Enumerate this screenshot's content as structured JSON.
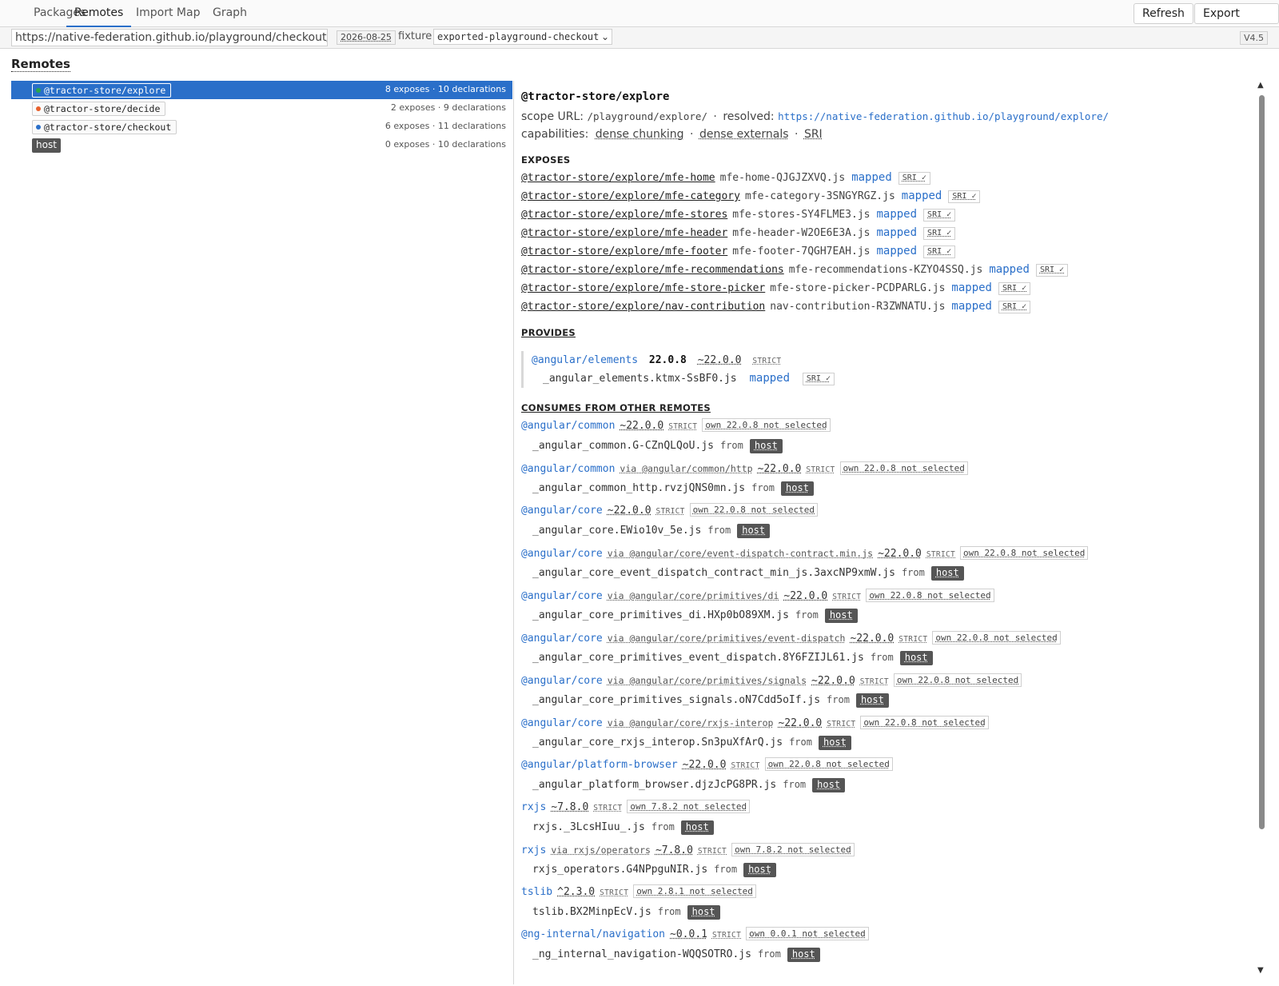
{
  "tabs": [
    "Packages",
    "Remotes",
    "Import Map",
    "Graph"
  ],
  "actions": {
    "refresh": "Refresh",
    "export": "Export JSON"
  },
  "urlbar": {
    "url": "https://native-federation.github.io/playground/checkout/cart",
    "date": "2026-08-25",
    "fixture_label": "fixture",
    "fixture_value": "exported-playground-checkout",
    "version": "V4.5"
  },
  "section_title": "Remotes",
  "remotes": [
    {
      "name": "@tractor-store/explore",
      "counts": "8 exposes · 10 declarations",
      "dot": "#2aa84a"
    },
    {
      "name": "@tractor-store/decide",
      "counts": "2 exposes · 9 declarations",
      "dot": "#e8602c"
    },
    {
      "name": "@tractor-store/checkout",
      "counts": "6 exposes · 11 declarations",
      "dot": "#2a6fc9"
    },
    {
      "name": "host",
      "counts": "0 exposes · 10 declarations"
    }
  ],
  "detail": {
    "title": "@tractor-store/explore",
    "scope_label": "scope URL:",
    "scope": "/playground/explore/",
    "sep": "·",
    "resolved_label": "resolved:",
    "resolved": "https://native-federation.github.io/playground/explore/",
    "capabilities_label": "capabilities:",
    "capabilities": [
      "dense chunking",
      "dense externals",
      "SRI"
    ],
    "exposes_header": "EXPOSES",
    "mapped_label": "mapped",
    "sri_label": "SRI ✓",
    "exposes": [
      {
        "name": "@tractor-store/explore/mfe-home",
        "file": "mfe-home-QJGJZXVQ.js"
      },
      {
        "name": "@tractor-store/explore/mfe-category",
        "file": "mfe-category-3SNGYRGZ.js"
      },
      {
        "name": "@tractor-store/explore/mfe-stores",
        "file": "mfe-stores-SY4FLME3.js"
      },
      {
        "name": "@tractor-store/explore/mfe-header",
        "file": "mfe-header-W2OE6E3A.js"
      },
      {
        "name": "@tractor-store/explore/mfe-footer",
        "file": "mfe-footer-7QGH7EAH.js"
      },
      {
        "name": "@tractor-store/explore/mfe-recommendations",
        "file": "mfe-recommendations-KZYO4SSQ.js"
      },
      {
        "name": "@tractor-store/explore/mfe-store-picker",
        "file": "mfe-store-picker-PCDPARLG.js"
      },
      {
        "name": "@tractor-store/explore/nav-contribution",
        "file": "nav-contribution-R3ZWNATU.js"
      }
    ],
    "provides_header": "PROVIDES",
    "provides": {
      "pkg": "@angular/elements",
      "version": "22.0.8",
      "range": "~22.0.0",
      "strict": "STRICT",
      "file": "_angular_elements.ktmx-SsBF0.js"
    },
    "consumes_header": "CONSUMES FROM OTHER REMOTES",
    "from_label": "from",
    "consumes": [
      {
        "pkg": "@angular/common",
        "via": "",
        "range": "~22.0.0",
        "strict": "STRICT",
        "own": "own 22.0.8 not selected",
        "file": "_angular_common.G-CZnQLQoU.js",
        "source": "host"
      },
      {
        "pkg": "@angular/common",
        "via": "via @angular/common/http",
        "range": "~22.0.0",
        "strict": "STRICT",
        "own": "own 22.0.8 not selected",
        "file": "_angular_common_http.rvzjQNS0mn.js",
        "source": "host"
      },
      {
        "pkg": "@angular/core",
        "via": "",
        "range": "~22.0.0",
        "strict": "STRICT",
        "own": "own 22.0.8 not selected",
        "file": "_angular_core.EWio10v_5e.js",
        "source": "host"
      },
      {
        "pkg": "@angular/core",
        "via": "via @angular/core/event-dispatch-contract.min.js",
        "range": "~22.0.0",
        "strict": "STRICT",
        "own": "own 22.0.8 not selected",
        "file": "_angular_core_event_dispatch_contract_min_js.3axcNP9xmW.js",
        "source": "host"
      },
      {
        "pkg": "@angular/core",
        "via": "via @angular/core/primitives/di",
        "range": "~22.0.0",
        "strict": "STRICT",
        "own": "own 22.0.8 not selected",
        "file": "_angular_core_primitives_di.HXp0bO89XM.js",
        "source": "host"
      },
      {
        "pkg": "@angular/core",
        "via": "via @angular/core/primitives/event-dispatch",
        "range": "~22.0.0",
        "strict": "STRICT",
        "own": "own 22.0.8 not selected",
        "file": "_angular_core_primitives_event_dispatch.8Y6FZIJL61.js",
        "source": "host"
      },
      {
        "pkg": "@angular/core",
        "via": "via @angular/core/primitives/signals",
        "range": "~22.0.0",
        "strict": "STRICT",
        "own": "own 22.0.8 not selected",
        "file": "_angular_core_primitives_signals.oN7Cdd5oIf.js",
        "source": "host"
      },
      {
        "pkg": "@angular/core",
        "via": "via @angular/core/rxjs-interop",
        "range": "~22.0.0",
        "strict": "STRICT",
        "own": "own 22.0.8 not selected",
        "file": "_angular_core_rxjs_interop.Sn3puXfArQ.js",
        "source": "host"
      },
      {
        "pkg": "@angular/platform-browser",
        "via": "",
        "range": "~22.0.0",
        "strict": "STRICT",
        "own": "own 22.0.8 not selected",
        "file": "_angular_platform_browser.djzJcPG8PR.js",
        "source": "host"
      },
      {
        "pkg": "rxjs",
        "via": "",
        "range": "~7.8.0",
        "strict": "STRICT",
        "own": "own 7.8.2 not selected",
        "file": "rxjs._3LcsHIuu_.js",
        "source": "host"
      },
      {
        "pkg": "rxjs",
        "via": "via rxjs/operators",
        "range": "~7.8.0",
        "strict": "STRICT",
        "own": "own 7.8.2 not selected",
        "file": "rxjs_operators.G4NPpguNIR.js",
        "source": "host"
      },
      {
        "pkg": "tslib",
        "via": "",
        "range": "^2.3.0",
        "strict": "STRICT",
        "own": "own 2.8.1 not selected",
        "file": "tslib.BX2MinpEcV.js",
        "source": "host"
      },
      {
        "pkg": "@ng-internal/navigation",
        "via": "",
        "range": "~0.0.1",
        "strict": "STRICT",
        "own": "own 0.0.1 not selected",
        "file": "_ng_internal_navigation-WQQSOTRO.js",
        "source": "host"
      }
    ]
  },
  "colors": {
    "accent": "#2a6fc9",
    "host_badge": "#555555"
  }
}
